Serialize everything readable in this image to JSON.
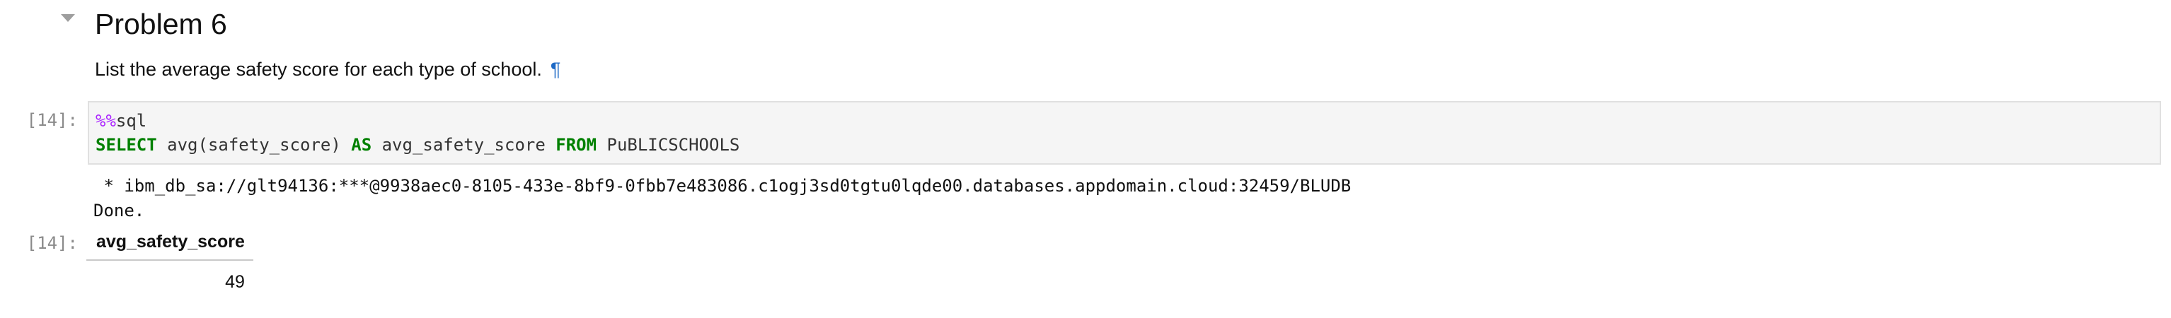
{
  "markdown": {
    "heading": "Problem 6",
    "paragraph": "List the average safety score for each type of school.",
    "anchor_symbol": "¶"
  },
  "code_cell": {
    "prompt": "[14]:",
    "line1": {
      "magic": "%%",
      "rest": "sql"
    },
    "line2": {
      "kw_select": "SELECT",
      "part1": " avg(safety_score) ",
      "kw_as": "AS",
      "part2": " avg_safety_score ",
      "kw_from": "FROM",
      "part3": " PuBLICSCHOOLS"
    }
  },
  "output": {
    "connection": " * ibm_db_sa://glt94136:***@9938aec0-8105-433e-8bf9-0fbb7e483086.c1ogj3sd0tgtu0lqde00.databases.appdomain.cloud:32459/BLUDB",
    "status": "Done.",
    "prompt": "[14]:",
    "table": {
      "header": "avg_safety_score",
      "value": "49"
    }
  },
  "colors": {
    "magic": "#aa22ff",
    "keyword": "#008000",
    "anchor": "#1e6ac6"
  }
}
